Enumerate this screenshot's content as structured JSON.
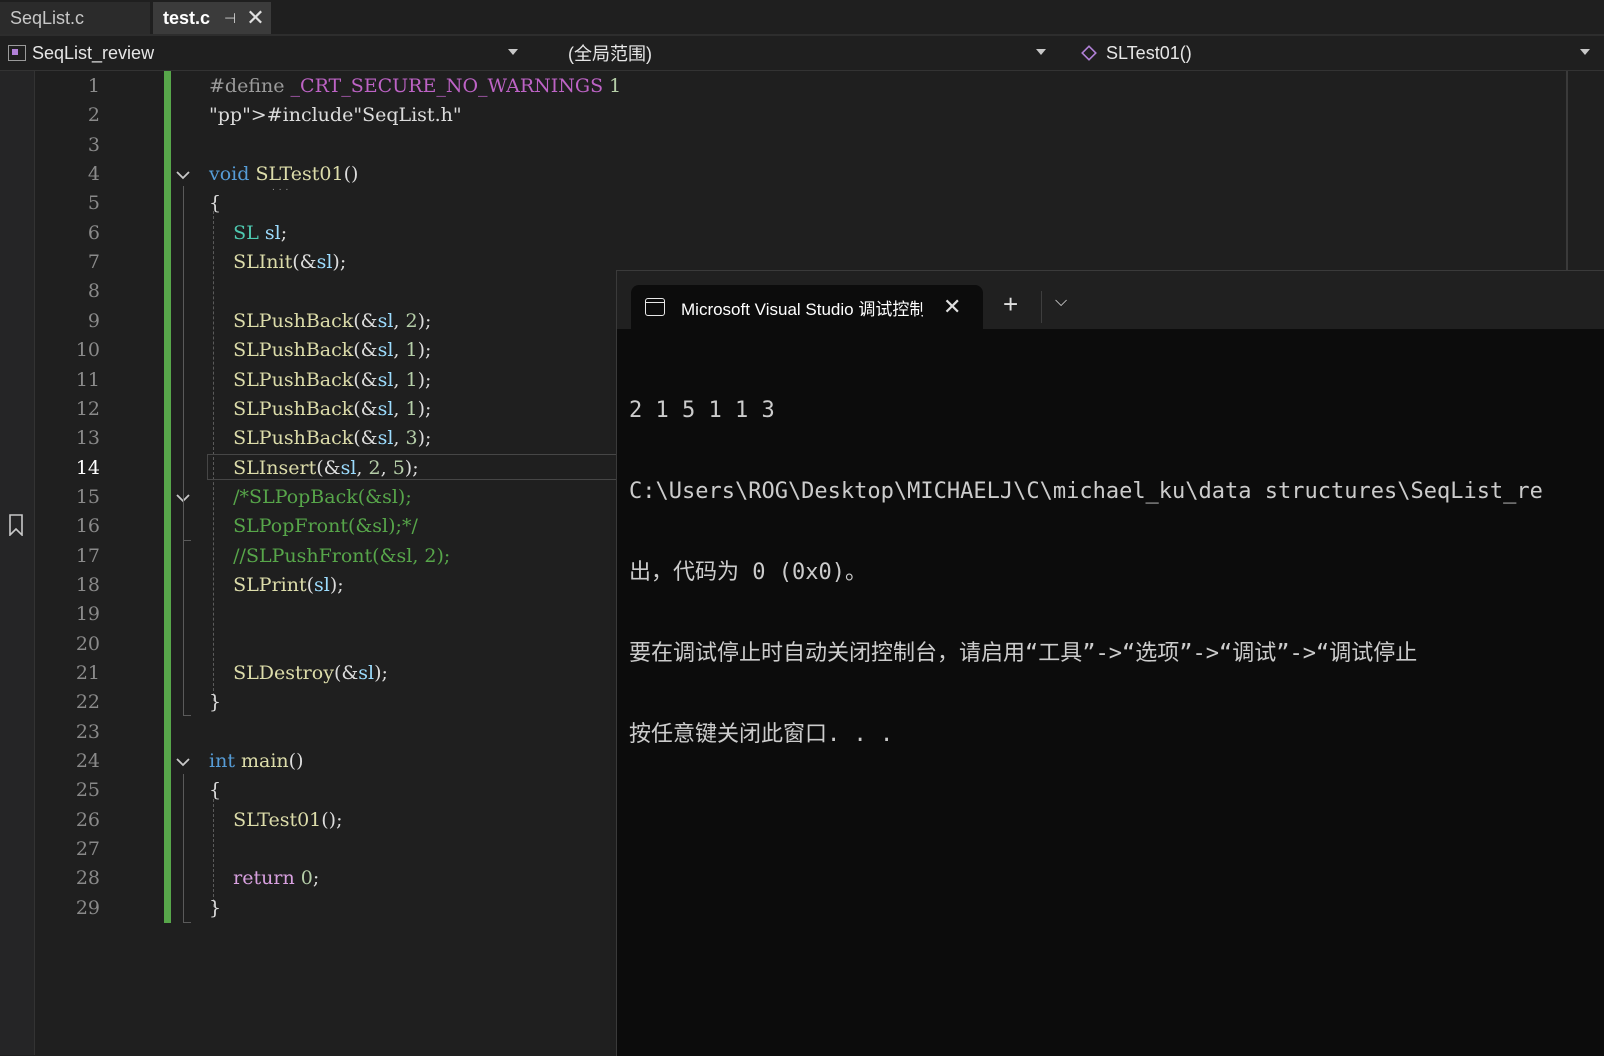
{
  "tabs": [
    {
      "label": "SeqList.c",
      "active": false
    },
    {
      "label": "test.c",
      "active": true
    }
  ],
  "navbar": {
    "project": "SeqList_review",
    "scope": "(全局范围)",
    "member": "SLTest01()"
  },
  "editor": {
    "active_line": 14,
    "line_numbers": [
      "1",
      "2",
      "3",
      "4",
      "5",
      "6",
      "7",
      "8",
      "9",
      "10",
      "11",
      "12",
      "13",
      "14",
      "15",
      "16",
      "17",
      "18",
      "19",
      "20",
      "21",
      "22",
      "23",
      "24",
      "25",
      "26",
      "27",
      "28",
      "29"
    ],
    "lines": [
      "#define _CRT_SECURE_NO_WARNINGS 1",
      "#include\"SeqList.h\"",
      "",
      "void SLTest01()",
      "{",
      "    SL sl;",
      "    SLInit(&sl);",
      "",
      "    SLPushBack(&sl, 2);",
      "    SLPushBack(&sl, 1);",
      "    SLPushBack(&sl, 1);",
      "    SLPushBack(&sl, 1);",
      "    SLPushBack(&sl, 3);",
      "    SLInsert(&sl, 2, 5);",
      "    /*SLPopBack(&sl);",
      "    SLPopFront(&sl);*/",
      "    //SLPushFront(&sl, 2);",
      "    SLPrint(sl);",
      "",
      "",
      "    SLDestroy(&sl);",
      "}",
      "",
      "int main()",
      "{",
      "    SLTest01();",
      "",
      "    return 0;",
      "}"
    ]
  },
  "terminal": {
    "tab_title": "Microsoft Visual Studio 调试控制台",
    "new_tab_label": "+",
    "output": [
      "2 1 5 1 1 3",
      "C:\\Users\\ROG\\Desktop\\MICHAELJ\\C\\michael_ku\\data structures\\SeqList_re",
      "出，代码为 0 (0x0)。",
      "要在调试停止时自动关闭控制台，请启用“工具”->“选项”->“调试”->“调试停止",
      "按任意键关闭此窗口. . ."
    ]
  },
  "colors": {
    "editor_bg": "#1f1f1f",
    "change_bar": "#57a64a",
    "keyword": "#569cd6",
    "function": "#dcdcaa",
    "type": "#4ec9b0",
    "comment": "#57a64a",
    "terminal_bg": "#0c0c0c"
  },
  "icons": [
    "project-icon",
    "cube-icon",
    "bookmark-icon",
    "fold-chevron-icon",
    "terminal-icon",
    "close-icon",
    "pin-icon",
    "chevron-down-icon",
    "plus-icon"
  ]
}
